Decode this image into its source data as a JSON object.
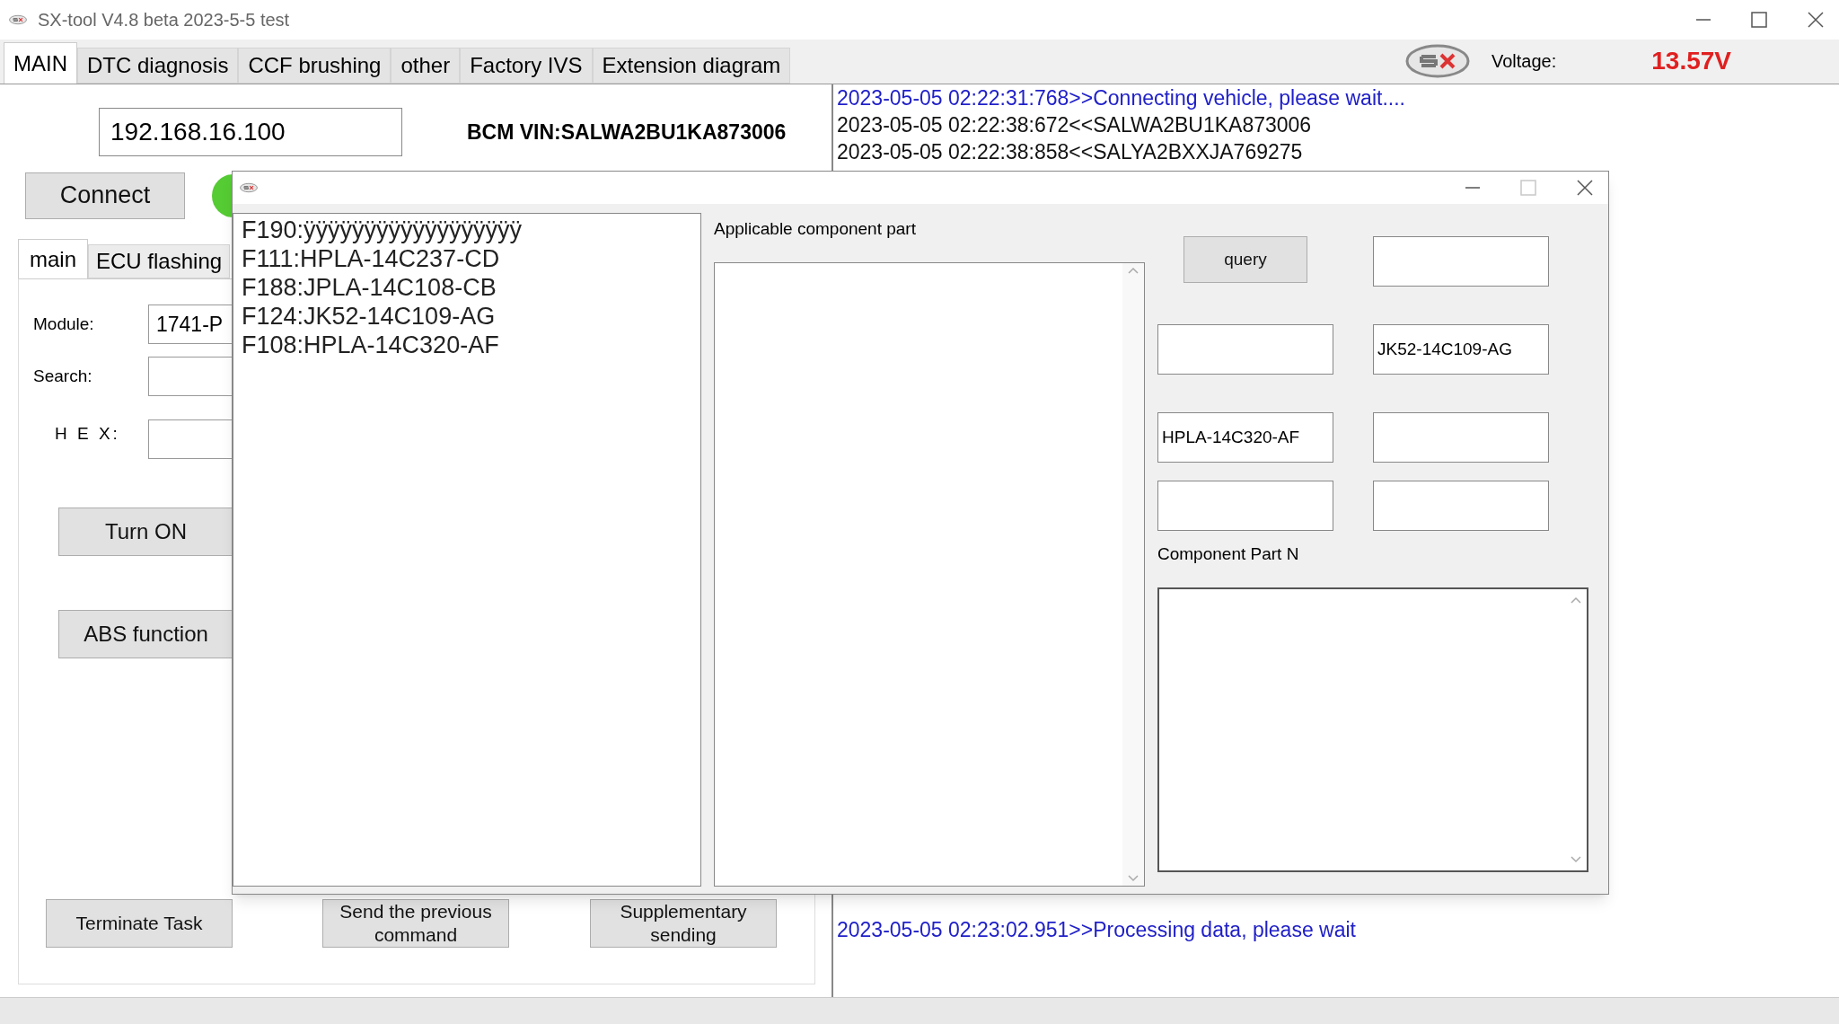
{
  "window": {
    "title": "SX-tool V4.8 beta 2023-5-5 test"
  },
  "tabs": [
    {
      "label": "MAIN",
      "selected": true
    },
    {
      "label": "DTC diagnosis",
      "selected": false
    },
    {
      "label": "CCF brushing",
      "selected": false
    },
    {
      "label": "other",
      "selected": false
    },
    {
      "label": "Factory IVS",
      "selected": false
    },
    {
      "label": "Extension diagram",
      "selected": false
    }
  ],
  "voltage": {
    "label": "Voltage:",
    "value": "13.57V"
  },
  "ip_field": {
    "value": "192.168.16.100"
  },
  "vin": "BCM VIN:SALWA2BU1KA873006",
  "connect_button": "Connect",
  "subtabs": [
    {
      "label": "main",
      "selected": true
    },
    {
      "label": "ECU flashing",
      "selected": false
    }
  ],
  "form": [
    {
      "label": "Module:",
      "value": "1741-P"
    },
    {
      "label": "Search:"
    },
    {
      "label": "H E X:"
    }
  ],
  "action_buttons": [
    "Turn ON",
    "ABS function"
  ],
  "bottom_buttons": [
    "Terminate Task",
    "Send the previous command",
    "Supplementary sending"
  ],
  "log": {
    "top_lines": [
      {
        "text": "2023-05-05 02:22:31:768>>Connecting vehicle, please wait....",
        "kind": "sent"
      },
      {
        "text": "2023-05-05 02:22:38:672<<SALWA2BU1KA873006",
        "kind": "received"
      },
      {
        "text": "2023-05-05 02:22:38:858<<SALYA2BXXJA769275",
        "kind": "received"
      }
    ],
    "latest_lines": [
      {
        "text": "2023-05-05 02:23:02.951>>Processing data, please wait",
        "kind": "sent"
      }
    ]
  },
  "dialog": {
    "maximize_disabled": true,
    "dids": [
      "F190:ÿÿÿÿÿÿÿÿÿÿÿÿÿÿÿÿÿÿ",
      "F111:HPLA-14C237-CD",
      "F188:JPLA-14C108-CB",
      "F124:JK52-14C109-AG",
      "F108:HPLA-14C320-AF"
    ],
    "applicable_label": "Applicable component part",
    "grid_rows": [
      [
        {
          "kind": "button",
          "label": "query"
        },
        {
          "kind": "field"
        }
      ],
      [
        {
          "kind": "field"
        },
        {
          "kind": "field",
          "value": "JK52-14C109-AG"
        }
      ],
      [
        {
          "kind": "field",
          "value": "HPLA-14C320-AF"
        },
        {
          "kind": "field"
        }
      ],
      [
        {
          "kind": "field"
        },
        {
          "kind": "field"
        }
      ]
    ],
    "component_label": "Component Part N"
  }
}
